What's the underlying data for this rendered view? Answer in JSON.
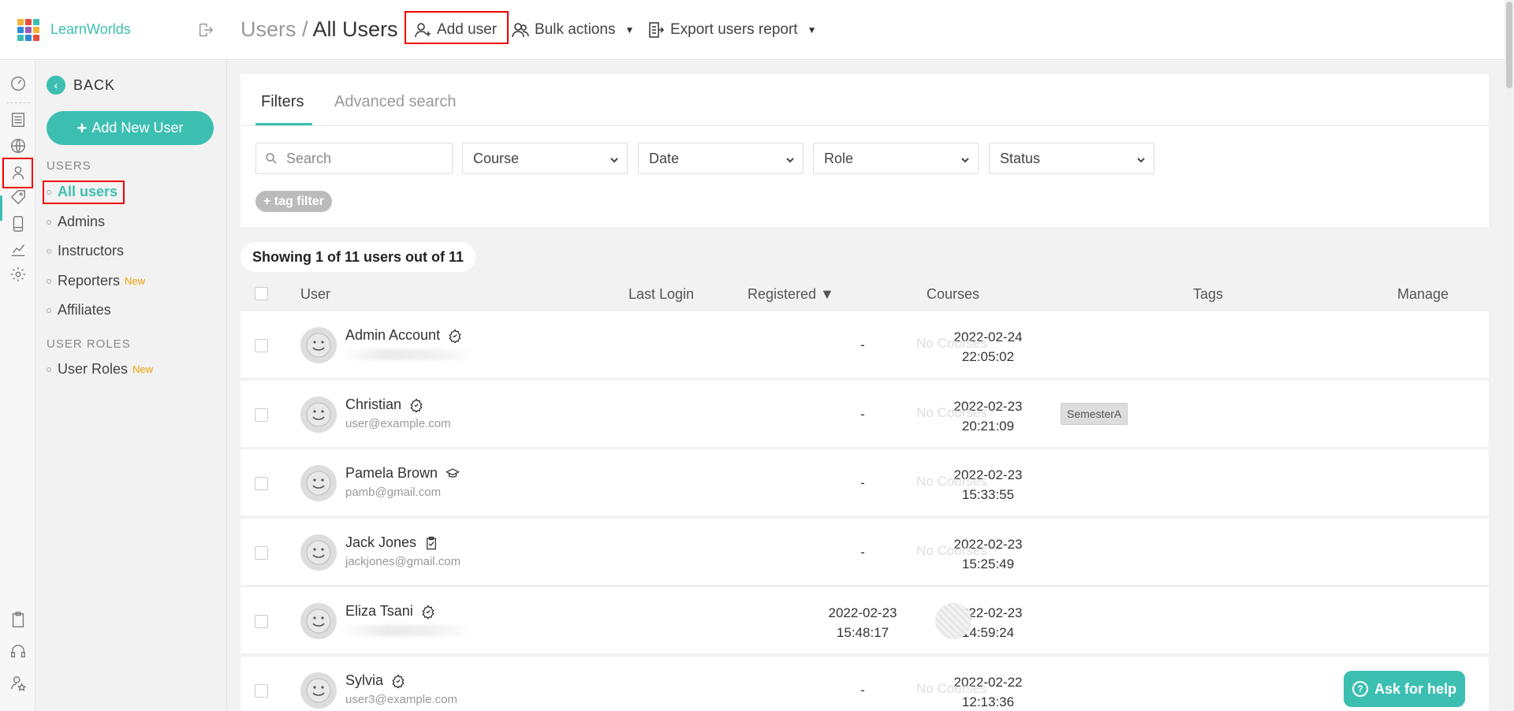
{
  "brand": {
    "name": "LearnWorlds"
  },
  "header": {
    "breadcrumb_parent": "Users",
    "breadcrumb_separator": " / ",
    "breadcrumb_current": "All Users",
    "add_user": "Add user",
    "bulk_actions": "Bulk actions",
    "export_report": "Export users report"
  },
  "sidebar": {
    "back": "BACK",
    "add_new_user": "Add New User",
    "users_section": "USERS",
    "items": [
      {
        "label": "All users",
        "badge": ""
      },
      {
        "label": "Admins",
        "badge": ""
      },
      {
        "label": "Instructors",
        "badge": ""
      },
      {
        "label": "Reporters",
        "badge": "New"
      },
      {
        "label": "Affiliates",
        "badge": ""
      }
    ],
    "roles_section": "USER ROLES",
    "role_items": [
      {
        "label": "User Roles",
        "badge": "New"
      }
    ]
  },
  "filters": {
    "tabs": [
      "Filters",
      "Advanced search"
    ],
    "search_placeholder": "Search",
    "selects": [
      "Course",
      "Date",
      "Role",
      "Status"
    ],
    "tag_filter": "+ tag filter"
  },
  "showing": "Showing 1 of 11 users out of 11",
  "table": {
    "columns": [
      "User",
      "Last Login",
      "Registered ▼",
      "Courses",
      "Tags",
      "Manage"
    ],
    "rows": [
      {
        "name": "Admin Account",
        "email": "",
        "role_icon": "admin-gear-icon",
        "last_login": [
          "-",
          ""
        ],
        "registered": [
          "2022-02-24",
          "22:05:02"
        ],
        "courses": "No Courses",
        "tags": ""
      },
      {
        "name": "Christian",
        "email": "user@example.com",
        "role_icon": "admin-gear-icon",
        "last_login": [
          "-",
          ""
        ],
        "registered": [
          "2022-02-23",
          "20:21:09"
        ],
        "courses": "No Courses",
        "tags": "SemesterA"
      },
      {
        "name": "Pamela Brown",
        "email": "pamb@gmail.com",
        "role_icon": "graduation-cap-icon",
        "last_login": [
          "-",
          ""
        ],
        "registered": [
          "2022-02-23",
          "15:33:55"
        ],
        "courses": "No Courses",
        "tags": ""
      },
      {
        "name": "Jack Jones",
        "email": "jackjones@gmail.com",
        "role_icon": "clipboard-check-icon",
        "last_login": [
          "-",
          ""
        ],
        "registered": [
          "2022-02-23",
          "15:25:49"
        ],
        "courses": "No Courses",
        "tags": ""
      },
      {
        "name": "Eliza Tsani",
        "email": "",
        "role_icon": "admin-gear-icon",
        "last_login": [
          "2022-02-23",
          "15:48:17"
        ],
        "registered": [
          "2022-02-23",
          "14:59:24"
        ],
        "courses": "",
        "tags": ""
      },
      {
        "name": "Sylvia",
        "email": "user3@example.com",
        "role_icon": "admin-gear-icon",
        "last_login": [
          "-",
          ""
        ],
        "registered": [
          "2022-02-22",
          "12:13:36"
        ],
        "courses": "No Courses",
        "tags": ""
      }
    ]
  },
  "help": {
    "label": "Ask for help"
  },
  "colors": {
    "accent": "#3cbfb1",
    "highlight": "#e00000",
    "new_badge": "#f0a000"
  }
}
